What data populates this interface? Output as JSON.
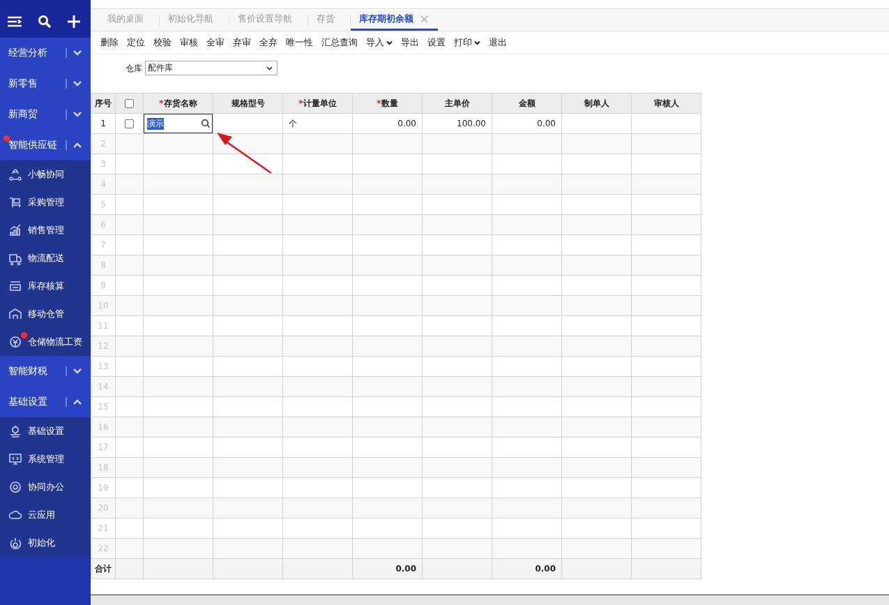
{
  "sidebar": {
    "groups": [
      {
        "label": "经营分析",
        "expanded": false,
        "notification": false
      },
      {
        "label": "新零售",
        "expanded": false,
        "notification": false
      },
      {
        "label": "新商贸",
        "expanded": false,
        "notification": false
      },
      {
        "label": "智能供应链",
        "expanded": true,
        "notification": true,
        "children": [
          {
            "label": "小畅协同",
            "notification": false
          },
          {
            "label": "采购管理",
            "notification": false
          },
          {
            "label": "销售管理",
            "notification": false
          },
          {
            "label": "物流配送",
            "notification": false
          },
          {
            "label": "库存核算",
            "notification": false
          },
          {
            "label": "移动仓管",
            "notification": false
          },
          {
            "label": "仓储物流工资",
            "notification": true
          }
        ]
      },
      {
        "label": "智能财税",
        "expanded": false,
        "notification": false
      },
      {
        "label": "基础设置",
        "expanded": true,
        "notification": false,
        "children": [
          {
            "label": "基础设置",
            "notification": false
          },
          {
            "label": "系统管理",
            "notification": false
          },
          {
            "label": "协同办公",
            "notification": false
          },
          {
            "label": "云应用",
            "notification": false
          },
          {
            "label": "初始化",
            "notification": false
          }
        ]
      }
    ]
  },
  "tabs": [
    {
      "label": "我的桌面",
      "selected": false
    },
    {
      "label": "初始化导航",
      "selected": false
    },
    {
      "label": "售价设置导航",
      "selected": false
    },
    {
      "label": "存货",
      "selected": false
    },
    {
      "label": "库存期初余额",
      "selected": true,
      "closable": true
    }
  ],
  "toolbar": [
    {
      "label": "删除"
    },
    {
      "label": "定位"
    },
    {
      "label": "校验"
    },
    {
      "label": "审核"
    },
    {
      "label": "全审"
    },
    {
      "label": "弃审"
    },
    {
      "label": "全弃"
    },
    {
      "label": "唯一性"
    },
    {
      "label": "汇总查询"
    },
    {
      "label": "导入",
      "has_menu": true
    },
    {
      "label": "导出"
    },
    {
      "label": "设置"
    },
    {
      "label": "打印",
      "has_menu": true
    },
    {
      "label": "退出"
    }
  ],
  "filter": {
    "label": "仓库",
    "value": "配件库"
  },
  "table": {
    "index_header": "序号",
    "select_all_checked": false,
    "columns": [
      {
        "label": "存货名称",
        "required_mark": "*"
      },
      {
        "label": "规格型号"
      },
      {
        "label": "计量单位",
        "required_mark": "*"
      },
      {
        "label": "数量",
        "required_mark": "*"
      },
      {
        "label": "主单价"
      },
      {
        "label": "金额"
      },
      {
        "label": "制单人"
      },
      {
        "label": "审核人"
      }
    ],
    "rows": [
      {
        "no": "1",
        "checked": false,
        "name": "演示",
        "editing": true,
        "unit": "个",
        "quantity": "0.00",
        "unit_price": "100.00",
        "amount": "0.00"
      },
      {
        "no": "2"
      },
      {
        "no": "3"
      },
      {
        "no": "4"
      },
      {
        "no": "5"
      },
      {
        "no": "6"
      },
      {
        "no": "7"
      },
      {
        "no": "8"
      },
      {
        "no": "9"
      },
      {
        "no": "10"
      },
      {
        "no": "11"
      },
      {
        "no": "12"
      },
      {
        "no": "13"
      },
      {
        "no": "14"
      },
      {
        "no": "15"
      },
      {
        "no": "16"
      },
      {
        "no": "17"
      },
      {
        "no": "18"
      },
      {
        "no": "19"
      },
      {
        "no": "20"
      },
      {
        "no": "21"
      },
      {
        "no": "22"
      }
    ],
    "footer": {
      "label": "合计",
      "quantity": "0.00",
      "amount": "0.00"
    }
  }
}
